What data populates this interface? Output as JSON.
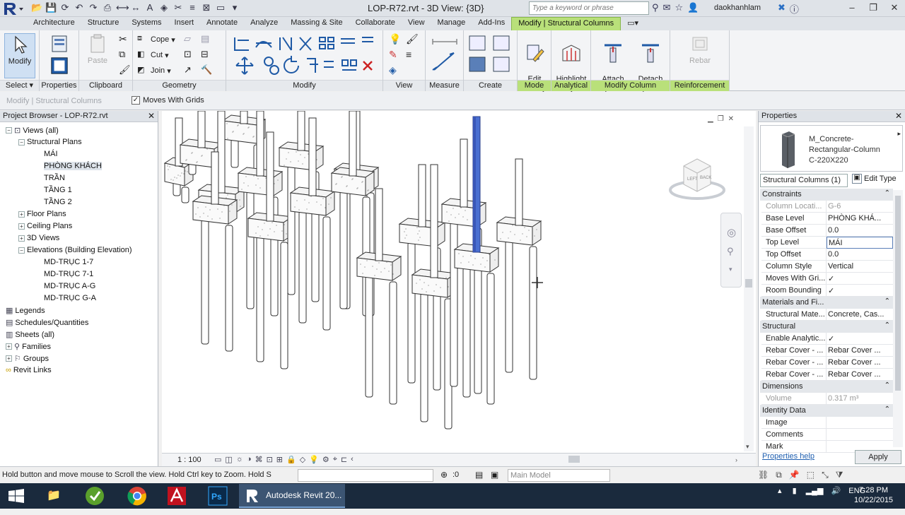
{
  "titlebar": {
    "title": "LOP-R72.rvt - 3D View: {3D}",
    "search_placeholder": "Type a keyword or phrase",
    "user": "daokhanhlam"
  },
  "tabs": [
    "Architecture",
    "Structure",
    "Systems",
    "Insert",
    "Annotate",
    "Analyze",
    "Massing & Site",
    "Collaborate",
    "View",
    "Manage",
    "Add-Ins",
    "Modify | Structural Columns"
  ],
  "ribbon": {
    "modify_label": "Modify",
    "select_label": "Select",
    "properties_panel_label": "Properties",
    "paste_label": "Paste",
    "clipboard_label": "Clipboard",
    "cope_label": "Cope",
    "cut_label": "Cut",
    "join_label": "Join",
    "geometry_label": "Geometry",
    "modify_panel_label": "Modify",
    "view_label": "View",
    "measure_label": "Measure",
    "create_label": "Create",
    "edit_family_label": "Edit\nFamily",
    "mode_label": "Mode",
    "highlight_analytical_label": "Highlight\nAnalytical",
    "analytical_label": "Analytical",
    "attach_label": "Attach\nTop/Base",
    "detach_label": "Detach\nTop/Base",
    "modify_column_label": "Modify Column",
    "rebar_label": "Rebar",
    "reinforcement_label": "Reinforcement"
  },
  "optbar": {
    "crumb": "Modify | Structural Columns",
    "moves_with_grids": "Moves With Grids"
  },
  "browser": {
    "title": "Project Browser - LOP-R72.rvt",
    "items": [
      {
        "label": "Views (all)",
        "exp": "−"
      },
      {
        "label": "Structural Plans",
        "exp": "−"
      },
      {
        "label": "MÁI",
        "exp": ""
      },
      {
        "label": "PHÒNG KHÁCH",
        "exp": ""
      },
      {
        "label": "TRẦN",
        "exp": ""
      },
      {
        "label": "TẦNG 1",
        "exp": ""
      },
      {
        "label": "TẦNG 2",
        "exp": ""
      },
      {
        "label": "Floor Plans",
        "exp": "+"
      },
      {
        "label": "Ceiling Plans",
        "exp": "+"
      },
      {
        "label": "3D Views",
        "exp": "+"
      },
      {
        "label": "Elevations (Building Elevation)",
        "exp": "−"
      },
      {
        "label": "MD-TRỤC 1-7",
        "exp": ""
      },
      {
        "label": "MD-TRỤC 7-1",
        "exp": ""
      },
      {
        "label": "MD-TRỤC A-G",
        "exp": ""
      },
      {
        "label": "MD-TRỤC G-A",
        "exp": ""
      },
      {
        "label": "Legends",
        "exp": ""
      },
      {
        "label": "Schedules/Quantities",
        "exp": ""
      },
      {
        "label": "Sheets (all)",
        "exp": ""
      },
      {
        "label": "Families",
        "exp": "+"
      },
      {
        "label": "Groups",
        "exp": "+"
      },
      {
        "label": "Revit Links",
        "exp": ""
      }
    ]
  },
  "viewport": {
    "scale": "1 : 100",
    "selected_color": "#4a6fd1"
  },
  "properties": {
    "title": "Properties",
    "type_name_1": "M_Concrete-",
    "type_name_2": "Rectangular-Column",
    "type_name_3": "C-220X220",
    "category": "Structural Columns (1)",
    "edit_type": "Edit Type",
    "groups": {
      "constraints": "Constraints",
      "materials": "Materials and Fi...",
      "structural": "Structural",
      "dimensions": "Dimensions",
      "identity": "Identity Data"
    },
    "rows": {
      "column_location": {
        "k": "Column Locati...",
        "v": "G-6"
      },
      "base_level": {
        "k": "Base Level",
        "v": "PHÒNG KHÁ..."
      },
      "base_offset": {
        "k": "Base Offset",
        "v": "0.0"
      },
      "top_level": {
        "k": "Top Level",
        "v": "MÁI"
      },
      "top_offset": {
        "k": "Top Offset",
        "v": "0.0"
      },
      "column_style": {
        "k": "Column Style",
        "v": "Vertical"
      },
      "moves_with_grids": {
        "k": "Moves With Gri...",
        "v": "✓"
      },
      "room_bounding": {
        "k": "Room Bounding",
        "v": "✓"
      },
      "structural_material": {
        "k": "Structural Mate...",
        "v": "Concrete, Cas..."
      },
      "enable_analytical": {
        "k": "Enable Analytic...",
        "v": "✓"
      },
      "rebar_cover_1": {
        "k": "Rebar Cover - ...",
        "v": "Rebar Cover ..."
      },
      "rebar_cover_2": {
        "k": "Rebar Cover - ...",
        "v": "Rebar Cover ..."
      },
      "rebar_cover_3": {
        "k": "Rebar Cover - ...",
        "v": "Rebar Cover ..."
      },
      "volume": {
        "k": "Volume",
        "v": "0.317 m³"
      },
      "image": {
        "k": "Image",
        "v": ""
      },
      "comments": {
        "k": "Comments",
        "v": ""
      },
      "mark": {
        "k": "Mark",
        "v": ""
      }
    },
    "help_link": "Properties help",
    "apply": "Apply"
  },
  "statusbar": {
    "text": "Hold button and move mouse to Scroll the view. Hold Ctrl key to Zoom. Hold S",
    "count": ":0",
    "model": "Main Model"
  },
  "taskbar": {
    "revit_task": "Autodesk Revit 20...",
    "lang": "ENG",
    "time": "7:28 PM",
    "date": "10/22/2015"
  }
}
